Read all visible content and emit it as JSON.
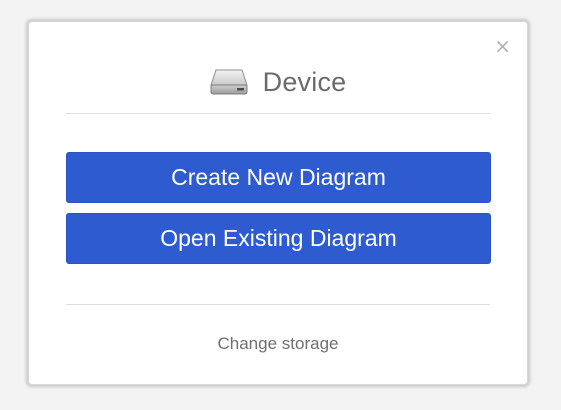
{
  "dialog": {
    "close_label": "×",
    "title": "Device",
    "title_icon": "hard-drive-icon",
    "buttons": {
      "create_label": "Create New Diagram",
      "open_label": "Open Existing Diagram"
    },
    "change_storage_label": "Change storage"
  },
  "colors": {
    "button": "#2f5bd1",
    "title_text": "#6b6b6b",
    "close": "#b4b4b4"
  }
}
